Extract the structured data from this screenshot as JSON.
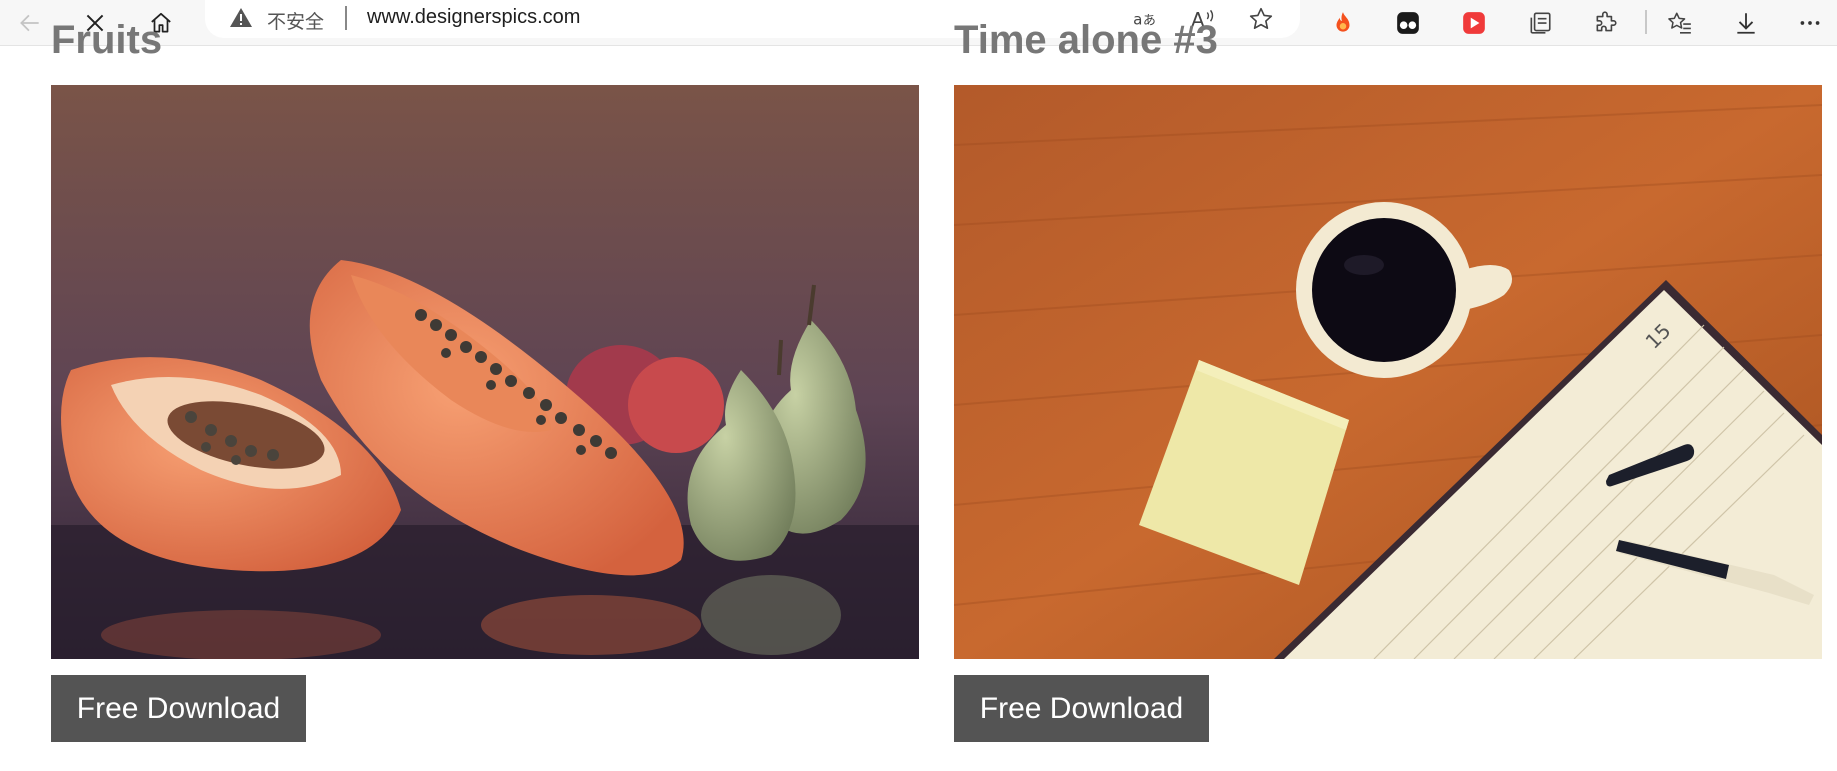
{
  "browser": {
    "security_label": "不安全",
    "url": "www.designerspics.com",
    "icons": {
      "back": "back-arrow-icon",
      "stop": "close-icon",
      "home": "home-icon",
      "warning": "warning-icon",
      "translate": "translate-icon",
      "read_aloud": "read-aloud-icon",
      "favorite": "star-icon",
      "ext1": "flame-extension-icon",
      "ext2": "tampermonkey-extension-icon",
      "ext3": "video-extension-icon",
      "collections": "collections-icon",
      "extensions": "puzzle-icon",
      "favorites": "favorites-icon",
      "downloads": "download-icon",
      "more": "more-icon"
    }
  },
  "gallery": {
    "cards": [
      {
        "title": "Fruits",
        "image": "papaya-pears-photo",
        "button_label": "Free Download"
      },
      {
        "title": "Time alone #3",
        "image": "coffee-notebook-photo",
        "button_label": "Free Download"
      }
    ]
  },
  "colors": {
    "button_bg": "#545454",
    "title_text": "#777777"
  }
}
